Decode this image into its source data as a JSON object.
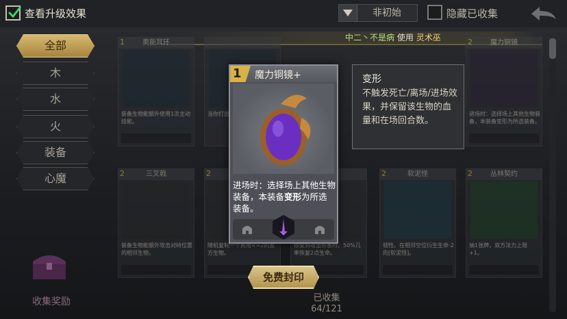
{
  "top": {
    "upgrade_label": "查看升级效果",
    "upgrade_checked": true,
    "sort_value": "非初始",
    "hide_collected_label": "隐藏已收集",
    "hide_collected_checked": false
  },
  "sidebar": {
    "items": [
      {
        "label": "全部",
        "active": true
      },
      {
        "label": "木",
        "active": false
      },
      {
        "label": "水",
        "active": false
      },
      {
        "label": "火",
        "active": false
      },
      {
        "label": "装备",
        "active": false
      },
      {
        "label": "心魔",
        "active": false
      }
    ],
    "reward_label": "收集奖励"
  },
  "banner": {
    "player": "中二丶不是病",
    "use_word": "使用",
    "hero": "灵术巫"
  },
  "cards": [
    {
      "cost": "1",
      "name": "奥能耳环",
      "desc": "装备生物能额外使用1次主动技能。"
    },
    {
      "cost": "2",
      "name": "魔力铜镜",
      "desc": "进场时：选择场上其他生物装备，本装备变形为所选装备。"
    },
    {
      "cost": "2",
      "name": "三叉戟",
      "desc": "装备生物能额外攻击对峙位置的相邻生物。"
    },
    {
      "cost": "2",
      "name": "",
      "desc": "随机复制一个费用<=2的友方生物。"
    },
    {
      "cost": "",
      "name": "",
      "desc": "你受到攻击伤害时，50%几率恢复2点生命。"
    },
    {
      "cost": "2",
      "name": "软泥怪",
      "desc": "韧性。在相邻空位衍生生命-2的[软泥怪]。"
    },
    {
      "cost": "2",
      "name": "丛林契约",
      "desc": "抽1张牌，双方法力上限+1。"
    }
  ],
  "cards_partial": {
    "left_frag": "当你打出1张牌，",
    "mid_frag": "武"
  },
  "focus_card": {
    "cost": "1",
    "name": "魔力铜镜+",
    "desc_pre": "进场时：选择场上其他生物装备，本装备",
    "desc_bold": "变形",
    "desc_post": "为所选装备。"
  },
  "tooltip": {
    "title": "变形",
    "body": "不触发死亡/离场/进场效果，并保留该生物的血量和在场回合数。"
  },
  "seal_button": "免费封印",
  "collection": {
    "label": "已收集",
    "count": "64/121"
  },
  "colors": {
    "accent_gold": "#d7b970",
    "banner_player": "#b8e07a",
    "banner_hero": "#f0d070",
    "gem_purple": "#6a2fc0"
  }
}
